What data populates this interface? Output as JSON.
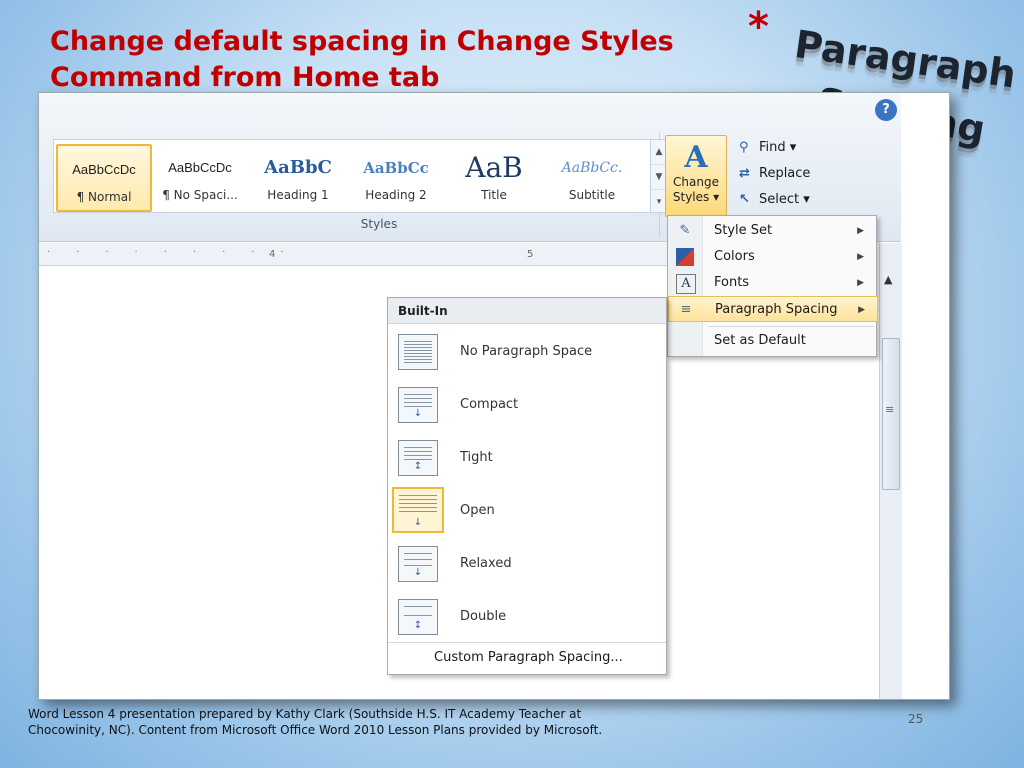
{
  "slide": {
    "title_line1": "Change default spacing in Change Styles",
    "title_line2": "Command from Home tab",
    "corner_asterisk": "*",
    "corner_title_line1": "Paragraph",
    "corner_title_line2": "Spacing",
    "credit_line1": "Word Lesson 4 presentation prepared by Kathy Clark (Southside H.S. IT Academy Teacher at",
    "credit_line2": "Chocowinity, NC). Content from Microsoft Office Word 2010 Lesson Plans provided by Microsoft.",
    "page_number": "25"
  },
  "ribbon": {
    "styles_group_label": "Styles",
    "gallery": [
      {
        "sample": "AaBbCcDc",
        "name": "¶ Normal",
        "selected": true
      },
      {
        "sample": "AaBbCcDc",
        "name": "¶ No Spaci...",
        "selected": false
      },
      {
        "sample": "AaBbC",
        "name": "Heading 1",
        "selected": false
      },
      {
        "sample": "AaBbCc",
        "name": "Heading 2",
        "selected": false
      },
      {
        "sample": "AaB",
        "name": "Title",
        "selected": false
      },
      {
        "sample": "AaBbCc.",
        "name": "Subtitle",
        "selected": false
      }
    ],
    "change_styles": {
      "icon": "A",
      "label_line1": "Change",
      "label_line2": "Styles ▾"
    },
    "editing": [
      {
        "icon": "binoculars-icon",
        "label": "Find ▾"
      },
      {
        "icon": "replace-icon",
        "label": "Replace"
      },
      {
        "icon": "cursor-icon",
        "label": "Select ▾"
      }
    ],
    "help_icon": "?"
  },
  "ruler": {
    "marks": [
      "4",
      "5"
    ]
  },
  "change_styles_menu": {
    "items": [
      {
        "label": "Style Set",
        "has_submenu": true,
        "icon": "style-set-icon"
      },
      {
        "label": "Colors",
        "has_submenu": true,
        "icon": "colors-icon"
      },
      {
        "label": "Fonts",
        "has_submenu": true,
        "icon": "fonts-icon"
      },
      {
        "label": "Paragraph Spacing",
        "has_submenu": true,
        "icon": "paragraph-spacing-icon",
        "highlighted": true
      },
      {
        "label": "Set as Default",
        "has_submenu": false,
        "icon": ""
      }
    ]
  },
  "paragraph_spacing_menu": {
    "header": "Built-In",
    "options": [
      {
        "label": "No Paragraph Space",
        "selected": false
      },
      {
        "label": "Compact",
        "selected": false
      },
      {
        "label": "Tight",
        "selected": false
      },
      {
        "label": "Open",
        "selected": true
      },
      {
        "label": "Relaxed",
        "selected": false
      },
      {
        "label": "Double",
        "selected": false
      }
    ],
    "footer": "Custom Paragraph Spacing..."
  }
}
